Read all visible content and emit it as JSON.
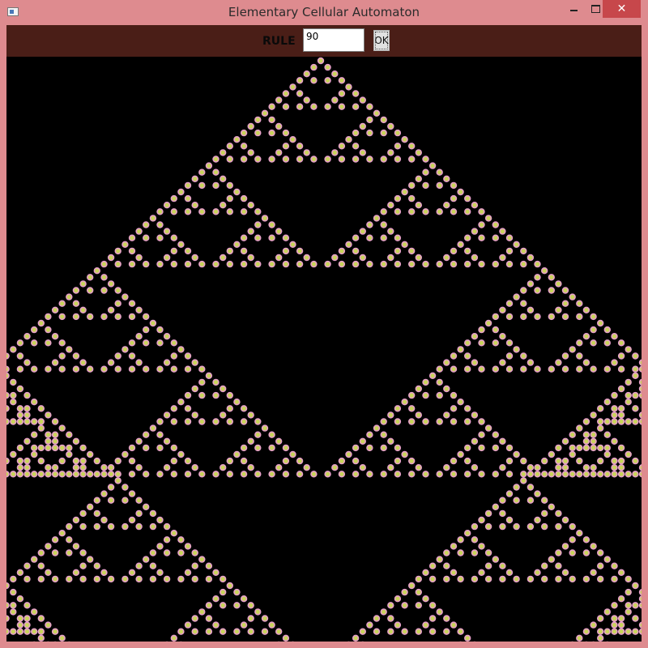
{
  "window": {
    "title": "Elementary Cellular Automaton",
    "close_label": "✕"
  },
  "toolbar": {
    "rule_label": "RULE",
    "rule_value": "90",
    "ok_label": "OK"
  },
  "automaton": {
    "rule": 90,
    "cell_fill_color": "#e6a0c8",
    "cell_core_color": "#c9d45a",
    "background_color": "#000000"
  },
  "colors": {
    "frame": "#de8b8f",
    "toolbar": "#4a1e17",
    "close_button": "#c7474b"
  }
}
